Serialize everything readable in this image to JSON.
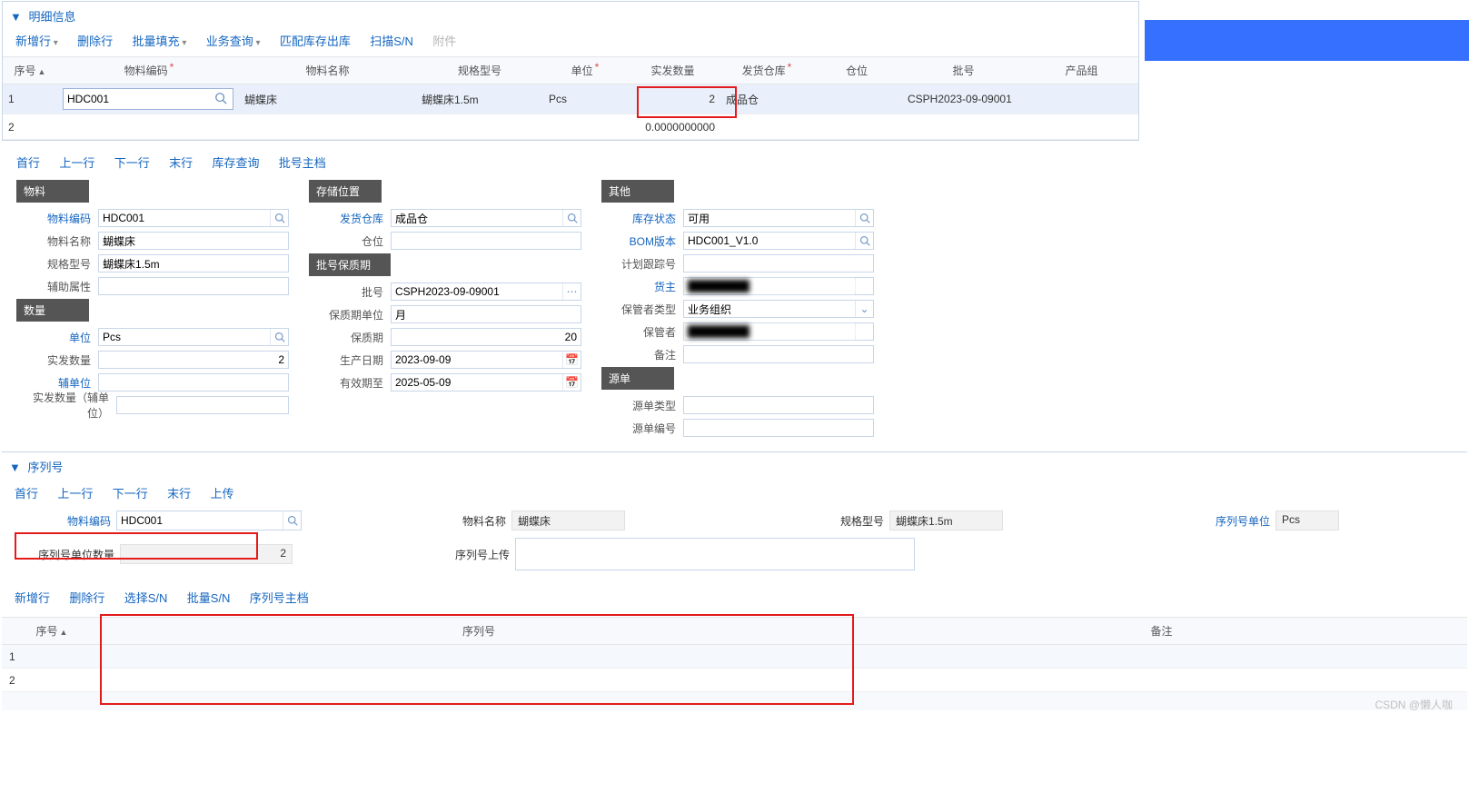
{
  "panel1": {
    "title": "明细信息",
    "toolbar": {
      "addRow": "新增行",
      "delRow": "删除行",
      "batchFill": "批量填充",
      "bizQuery": "业务查询",
      "matchStock": "匹配库存出库",
      "scanSN": "扫描S/N",
      "attachment": "附件"
    },
    "cols": {
      "seq": "序号",
      "matCode": "物料编码",
      "matName": "物料名称",
      "spec": "规格型号",
      "unit": "单位",
      "qty": "实发数量",
      "shipWh": "发货仓库",
      "bin": "仓位",
      "lot": "批号",
      "prodGrp": "产品组"
    },
    "rows": [
      {
        "seq": "1",
        "matCode": "HDC001",
        "matName": "蝴蝶床",
        "spec": "蝴蝶床1.5m",
        "unit": "Pcs",
        "qty": "2",
        "shipWh": "成品仓",
        "bin": "",
        "lot": "CSPH2023-09-09001",
        "prodGrp": ""
      },
      {
        "seq": "2",
        "matCode": "",
        "matName": "",
        "spec": "",
        "unit": "",
        "qty": "0.0000000000",
        "shipWh": "",
        "bin": "",
        "lot": "",
        "prodGrp": ""
      }
    ]
  },
  "linkbar": {
    "first": "首行",
    "prev": "上一行",
    "next": "下一行",
    "last": "末行",
    "stockQuery": "库存查询",
    "lotMaster": "批号主档"
  },
  "form": {
    "sect_material": "物料",
    "sect_qty": "数量",
    "sect_loc": "存储位置",
    "sect_lot": "批号保质期",
    "sect_other": "其他",
    "sect_src": "源单",
    "matCode_lbl": "物料编码",
    "matCode": "HDC001",
    "matName_lbl": "物料名称",
    "matName": "蝴蝶床",
    "spec_lbl": "规格型号",
    "spec": "蝴蝶床1.5m",
    "aux_lbl": "辅助属性",
    "aux": "",
    "unit_lbl": "单位",
    "unit": "Pcs",
    "actQty_lbl": "实发数量",
    "actQty": "2",
    "auxUnit_lbl": "辅单位",
    "auxUnit": "",
    "actQtyAux_lbl": "实发数量（辅单位）",
    "actQtyAux": "",
    "shipWh_lbl": "发货仓库",
    "shipWh": "成品仓",
    "bin_lbl": "仓位",
    "bin": "",
    "lot_lbl": "批号",
    "lot": "CSPH2023-09-09001",
    "shelfUnit_lbl": "保质期单位",
    "shelfUnit": "月",
    "shelf_lbl": "保质期",
    "shelf": "20",
    "prodDate_lbl": "生产日期",
    "prodDate": "2023-09-09",
    "expDate_lbl": "有效期至",
    "expDate": "2025-05-09",
    "stockStat_lbl": "库存状态",
    "stockStat": "可用",
    "bomVer_lbl": "BOM版本",
    "bomVer": "HDC001_V1.0",
    "trackNo_lbl": "计划跟踪号",
    "trackNo": "",
    "owner_lbl": "货主",
    "owner": "",
    "keeperType_lbl": "保管者类型",
    "keeperType": "业务组织",
    "keeper_lbl": "保管者",
    "keeper": "",
    "remark_lbl": "备注",
    "remark": "",
    "srcType_lbl": "源单类型",
    "srcType": "",
    "srcNo_lbl": "源单编号",
    "srcNo": ""
  },
  "panel2": {
    "title": "序列号",
    "links": {
      "first": "首行",
      "prev": "上一行",
      "next": "下一行",
      "last": "末行",
      "upload": "上传"
    },
    "hdr": {
      "matCode_lbl": "物料编码",
      "matCode": "HDC001",
      "matName_lbl": "物料名称",
      "matName": "蝴蝶床",
      "spec_lbl": "规格型号",
      "spec": "蝴蝶床1.5m",
      "snUnit_lbl": "序列号单位",
      "snUnit": "Pcs",
      "snQty_lbl": "序列号单位数量",
      "snQty": "2",
      "snUpload_lbl": "序列号上传"
    },
    "toolbar": {
      "addRow": "新增行",
      "delRow": "删除行",
      "selectSN": "选择S/N",
      "batchSN": "批量S/N",
      "snMaster": "序列号主档"
    },
    "cols": {
      "seq": "序号",
      "sn": "序列号",
      "remark": "备注"
    },
    "rows": [
      {
        "seq": "1"
      },
      {
        "seq": "2"
      }
    ]
  },
  "watermark": "CSDN @懒人咖"
}
